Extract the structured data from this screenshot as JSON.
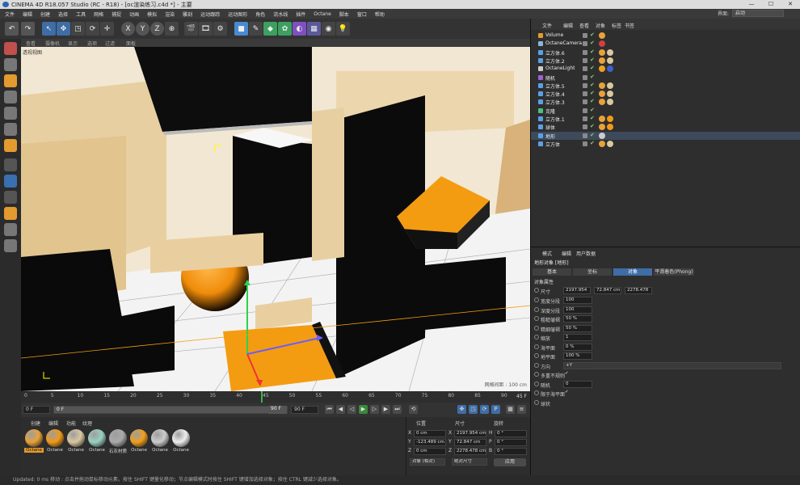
{
  "window": {
    "title": "CINEMA 4D R18.057 Studio (RC - R18) - [oc渲染练习.c4d *] - 主要",
    "min": "—",
    "max": "☐",
    "close": "✕"
  },
  "menubar": {
    "items": [
      "文件",
      "编辑",
      "创建",
      "选择",
      "工具",
      "网格",
      "捕捉",
      "动画",
      "模拟",
      "渲染",
      "雕刻",
      "运动跟踪",
      "运动图形",
      "角色",
      "流水线",
      "插件",
      "Octane",
      "脚本",
      "窗口",
      "帮助"
    ],
    "layout_label": "界面:",
    "layout_value": "启动"
  },
  "viewport": {
    "menu": [
      "查看",
      "摄像机",
      "显示",
      "选项",
      "过滤",
      "面板"
    ],
    "label": "透视视图",
    "grid_spacing": "网格间距 : 100 cm"
  },
  "timeline": {
    "ticks": [
      "0",
      "5",
      "10",
      "15",
      "20",
      "25",
      "30",
      "35",
      "40",
      "45",
      "50",
      "55",
      "60",
      "65",
      "70",
      "75",
      "80",
      "85",
      "90"
    ],
    "current_frame_label": "45",
    "current_frame": 45,
    "frame_readout": "45 F",
    "start_field": "0 F",
    "range_start": "0 F",
    "range_end": "90 F",
    "end_field": "90 F"
  },
  "materials": {
    "menu": [
      "创建",
      "编辑",
      "功能",
      "纹理"
    ],
    "items": [
      {
        "label": "Octane",
        "color": "#e8a23a"
      },
      {
        "label": "Octane",
        "color": "#f09a1a"
      },
      {
        "label": "Octane",
        "color": "#d9c8a0"
      },
      {
        "label": "Octane",
        "color": "#9ad0c0"
      },
      {
        "label": "石灰材质",
        "color": "#aaaaaa"
      },
      {
        "label": "Octane",
        "color": "#f0a020"
      },
      {
        "label": "Octane",
        "color": "#cccccc"
      },
      {
        "label": "Octane",
        "color": "#eeeeee"
      }
    ]
  },
  "coords": {
    "headers": [
      "位置",
      "尺寸",
      "旋转"
    ],
    "rows": [
      {
        "axis": "X",
        "pos": "0 cm",
        "size": "2197.954 cm",
        "rot_axis": "H",
        "rot": "0 °"
      },
      {
        "axis": "Y",
        "pos": "-123.489 cm",
        "size": "72.847 cm",
        "rot_axis": "P",
        "rot": "0 °"
      },
      {
        "axis": "Z",
        "pos": "0 cm",
        "size": "2278.478 cm",
        "rot_axis": "B",
        "rot": "0 °"
      }
    ],
    "mode_select": "对象 (相对)",
    "size_select": "绝对尺寸",
    "apply": "应用"
  },
  "status": {
    "text": "Updated: 0 ms    移动 : 点击并拖动鼠标移动元素。按住 SHIFT 键量化移动；节点编辑模式时按住 SHIFT 键增加选择对象；按住 CTRL 键减少选择对象。"
  },
  "objmgr": {
    "menu": [
      "文件",
      "编辑",
      "查看",
      "对象",
      "标签",
      "书签"
    ],
    "objects": [
      {
        "name": "Volume",
        "icon_color": "#e39a2f",
        "tags": [
          "#e8a23a"
        ]
      },
      {
        "name": "OctaneCamera",
        "icon_color": "#8ab4e0",
        "tags": [
          "#d04040"
        ]
      },
      {
        "name": "立方体.6",
        "icon_color": "#5aa0e6",
        "tags": [
          "#e8a23a",
          "#d9c8a0"
        ]
      },
      {
        "name": "立方体.2",
        "icon_color": "#5aa0e6",
        "tags": [
          "#e8a23a",
          "#d9c8a0"
        ]
      },
      {
        "name": "OctaneLight",
        "icon_color": "#cccccc",
        "tags": [
          "#f0a020",
          "#4060d0"
        ]
      },
      {
        "name": "随机",
        "icon_color": "#a060d0",
        "tags": []
      },
      {
        "name": "立方体.5",
        "icon_color": "#5aa0e6",
        "tags": [
          "#e8a23a",
          "#d9c8a0"
        ]
      },
      {
        "name": "立方体.4",
        "icon_color": "#5aa0e6",
        "tags": [
          "#e8a23a",
          "#d9c8a0"
        ]
      },
      {
        "name": "立方体.3",
        "icon_color": "#5aa0e6",
        "tags": [
          "#e8a23a",
          "#d9c8a0"
        ]
      },
      {
        "name": "克隆",
        "icon_color": "#4ac080",
        "tags": []
      },
      {
        "name": "立方体.1",
        "icon_color": "#5aa0e6",
        "tags": [
          "#e8a23a",
          "#f09a1a"
        ]
      },
      {
        "name": "球体",
        "icon_color": "#5aa0e6",
        "tags": [
          "#e8a23a",
          "#f09a1a"
        ]
      },
      {
        "name": "地形",
        "icon_color": "#5aa0e6",
        "tags": [
          "#cccccc"
        ]
      },
      {
        "name": "立方体",
        "icon_color": "#5aa0e6",
        "tags": [
          "#e8a23a",
          "#d9c8a0"
        ]
      }
    ]
  },
  "attrmgr": {
    "menu": [
      "模式",
      "编辑",
      "用户数据"
    ],
    "object_title": "地形对象 [地形]",
    "tabs": [
      "基本",
      "坐标",
      "对象",
      "平滑着色(Phong)"
    ],
    "active_tab": 2,
    "section": "对象属性",
    "size_label": "尺寸",
    "size_values": [
      "2197.954",
      "72.847 cm",
      "2278.478"
    ],
    "rows": [
      {
        "label": "宽度分段",
        "value": "100"
      },
      {
        "label": "深度分段",
        "value": "100"
      },
      {
        "label": "粗糙皱褶",
        "value": "50 %"
      },
      {
        "label": "精细皱褶",
        "value": "50 %"
      },
      {
        "label": "缩放",
        "value": "1"
      },
      {
        "label": "海平面",
        "value": "0 %"
      },
      {
        "label": "地平面",
        "value": "100 %"
      },
      {
        "label": "方向",
        "value": "+Y"
      },
      {
        "label": "多重不规则",
        "value": "✔"
      },
      {
        "label": "随机",
        "value": "0"
      },
      {
        "label": "限于海平面",
        "value": "✔"
      },
      {
        "label": "球状",
        "value": ""
      }
    ]
  },
  "colors": {
    "accent": "#3f6da6",
    "orange": "#f39c12",
    "floor": "#efe3cc",
    "wall": "#e5c896"
  }
}
